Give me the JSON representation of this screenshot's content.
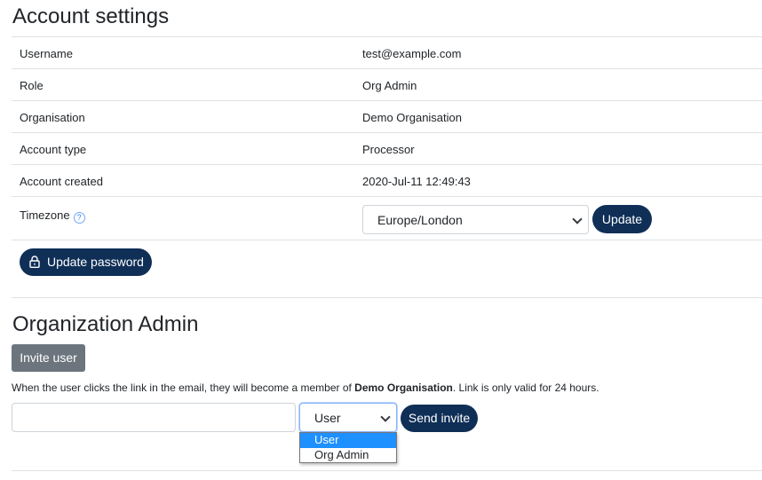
{
  "account": {
    "title": "Account settings",
    "rows": [
      {
        "label": "Username",
        "value": "test@example.com"
      },
      {
        "label": "Role",
        "value": "Org Admin"
      },
      {
        "label": "Organisation",
        "value": "Demo Organisation"
      },
      {
        "label": "Account type",
        "value": "Processor"
      },
      {
        "label": "Account created",
        "value": "2020-Jul-11 12:49:43"
      }
    ],
    "timezone": {
      "label": "Timezone",
      "help_icon": "?",
      "selected": "Europe/London",
      "update_label": "Update"
    },
    "update_password_label": "Update password"
  },
  "org_admin": {
    "title": "Organization Admin",
    "invite_button": "Invite user",
    "note_before": "When the user clicks the link in the email, they will become a member of ",
    "note_org": "Demo Organisation",
    "note_after": ". Link is only valid for 24 hours.",
    "email_value": "",
    "role_selected": "User",
    "role_options": [
      "User",
      "Org Admin"
    ],
    "send_label": "Send invite"
  },
  "colors": {
    "primary_dark": "#0f2f57",
    "secondary": "#6c757d",
    "option_highlight": "#1e90ff"
  }
}
